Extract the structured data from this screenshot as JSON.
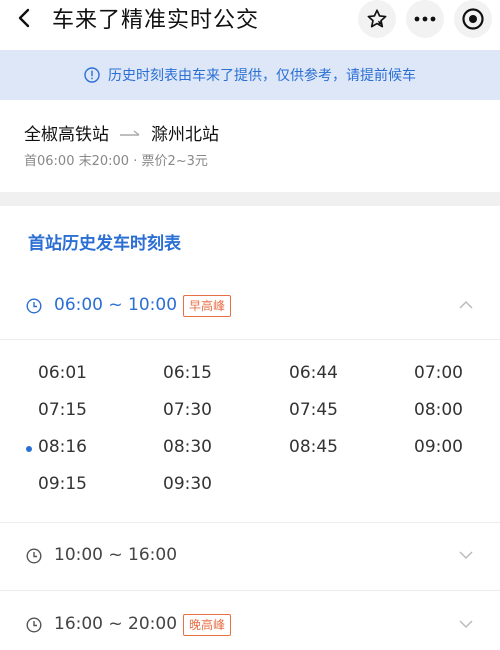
{
  "header": {
    "title": "车来了精准实时公交"
  },
  "banner": {
    "text": "历史时刻表由车来了提供，仅供参考，请提前候车"
  },
  "route": {
    "from": "全椒高铁站",
    "to": "滁州北站",
    "meta": "首06:00 末20:00 · 票价2~3元"
  },
  "section": {
    "title": "首站历史发车时刻表"
  },
  "periods": [
    {
      "range": "06:00 ~ 10:00",
      "badge": "早高峰",
      "expanded": true,
      "times": [
        "06:01",
        "06:15",
        "06:44",
        "07:00",
        "07:15",
        "07:30",
        "07:45",
        "08:00",
        "08:16",
        "08:30",
        "08:45",
        "09:00",
        "09:15",
        "09:30"
      ],
      "highlighted": "08:16"
    },
    {
      "range": "10:00 ~ 16:00",
      "badge": "",
      "expanded": false
    },
    {
      "range": "16:00 ~ 20:00",
      "badge": "晚高峰",
      "expanded": false
    }
  ],
  "colors": {
    "accent": "#2b6fd4",
    "badge": "#e76f46",
    "banner_bg": "#dde7f7"
  }
}
